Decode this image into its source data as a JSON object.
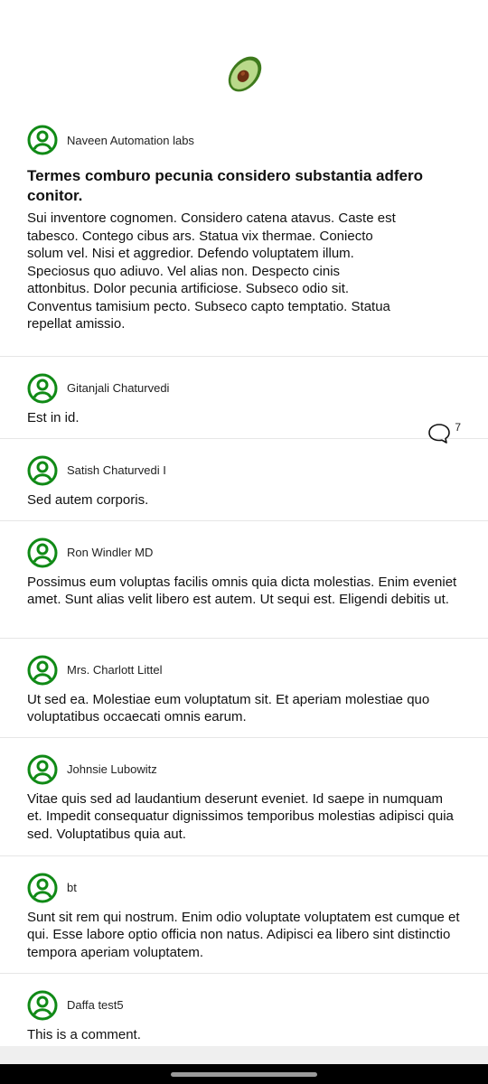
{
  "app": {
    "logo_icon": "avocado-icon",
    "accent_color": "#108a16"
  },
  "post": {
    "author": "Naveen Automation labs",
    "avatar_icon": "user-circle-icon",
    "title": "Termes comburo pecunia considero substantia adfero conitor.",
    "body": "Sui inventore cognomen. Considero catena atavus. Caste est tabesco. Contego cibus ars. Statua vix thermae. Coniecto solum vel. Nisi et aggredior. Defendo voluptatem illum. Speciosus quo adiuvo. Vel alias non. Despecto cinis attonbitus. Dolor pecunia artificiose. Subseco odio sit. Conventus tamisium pecto. Subseco capto temptatio. Statua repellat amissio.",
    "comment_icon": "comment-bubble-icon",
    "comment_count": "7"
  },
  "comments": [
    {
      "author": "Gitanjali Chaturvedi",
      "text": "Est in id."
    },
    {
      "author": "Satish Chaturvedi I",
      "text": "Sed autem corporis."
    },
    {
      "author": "Ron Windler MD",
      "text": "Possimus eum voluptas facilis omnis quia dicta molestias. Enim eveniet amet. Sunt alias velit libero est autem. Ut sequi est. Eligendi debitis ut."
    },
    {
      "author": "Mrs. Charlott Littel",
      "text": "Ut sed ea. Molestiae eum voluptatum sit. Et aperiam molestiae quo voluptatibus occaecati omnis earum."
    },
    {
      "author": "Johnsie Lubowitz",
      "text": "Vitae quis sed ad laudantium deserunt eveniet. Id saepe in numquam et. Impedit consequatur dignissimos temporibus molestias adipisci quia sed. Voluptatibus quia aut."
    },
    {
      "author": "bt",
      "text": "Sunt sit rem qui nostrum. Enim odio voluptate voluptatem est cumque et qui. Esse labore optio officia non natus. Adipisci ea libero sint distinctio tempora aperiam voluptatem."
    },
    {
      "author": "Daffa test5",
      "text": "This is a comment."
    }
  ]
}
